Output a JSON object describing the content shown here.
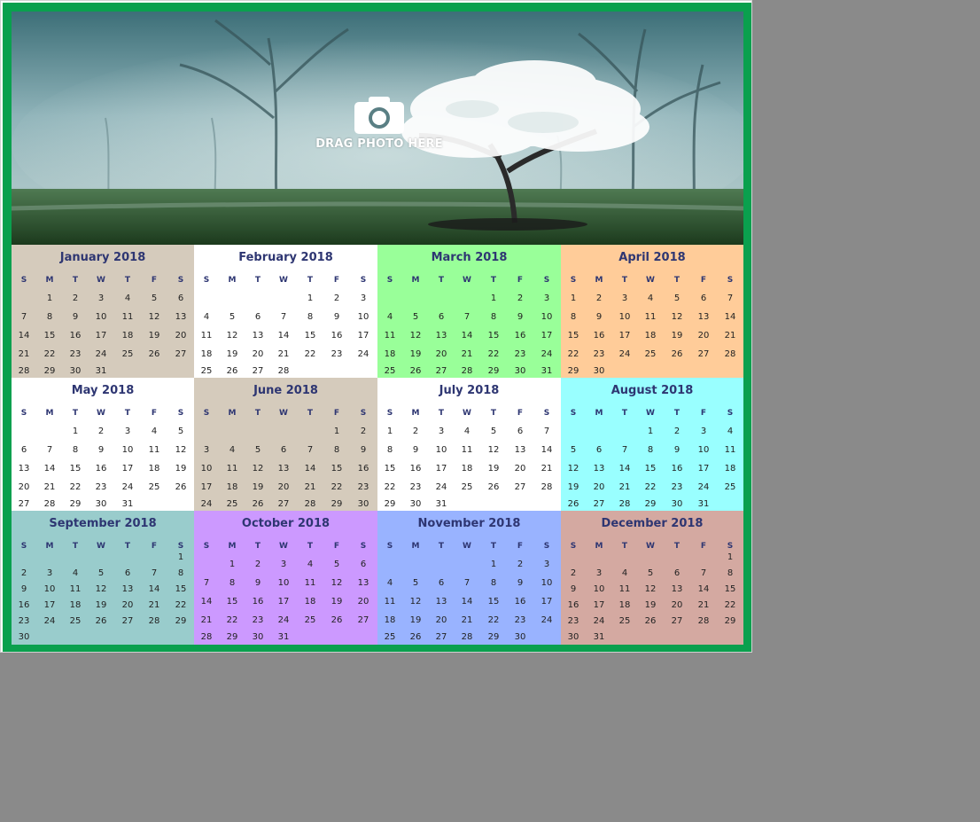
{
  "photo": {
    "drop_label": "DRAG PHOTO HERE",
    "icon": "camera-icon"
  },
  "colors": {
    "border": "#0aa04e",
    "title": "#2e3672",
    "background": "#8a8a8a"
  },
  "weekday_headers": [
    "S",
    "M",
    "T",
    "W",
    "T",
    "F",
    "S"
  ],
  "months": [
    {
      "title": "January 2018",
      "color": "#d5cbbc",
      "start": 1,
      "days": 31
    },
    {
      "title": "February 2018",
      "color": "#ffffff",
      "start": 4,
      "days": 28
    },
    {
      "title": "March 2018",
      "color": "#99ff99",
      "start": 4,
      "days": 31
    },
    {
      "title": "April 2018",
      "color": "#ffcc99",
      "start": 0,
      "days": 30
    },
    {
      "title": "May 2018",
      "color": "#ffffff",
      "start": 2,
      "days": 31
    },
    {
      "title": "June 2018",
      "color": "#d5cbbc",
      "start": 5,
      "days": 30
    },
    {
      "title": "July 2018",
      "color": "#ffffff",
      "start": 0,
      "days": 31
    },
    {
      "title": "August 2018",
      "color": "#99ffff",
      "start": 3,
      "days": 31
    },
    {
      "title": "September 2018",
      "color": "#99cccc",
      "start": 6,
      "days": 30
    },
    {
      "title": "October 2018",
      "color": "#cc99ff",
      "start": 1,
      "days": 31
    },
    {
      "title": "November 2018",
      "color": "#99b3ff",
      "start": 4,
      "days": 30
    },
    {
      "title": "December 2018",
      "color": "#d4a9a1",
      "start": 6,
      "days": 31
    }
  ]
}
